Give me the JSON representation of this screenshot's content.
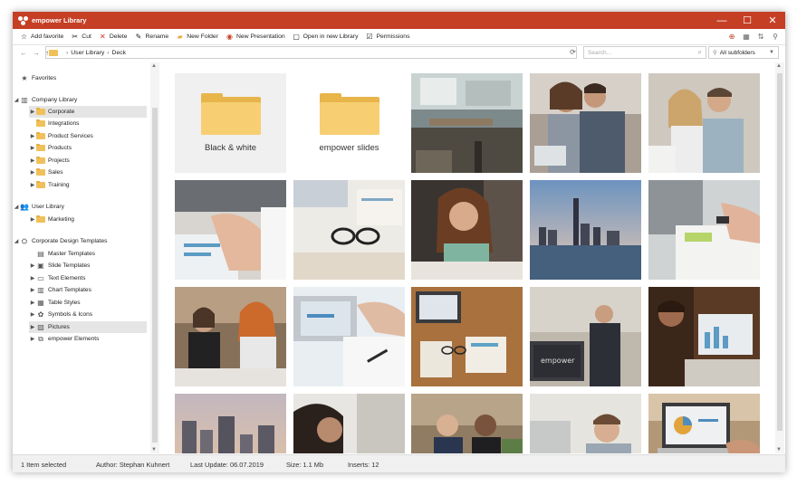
{
  "app": {
    "title": "empower Library"
  },
  "window_controls": {
    "minimize": "—",
    "maximize": "☐",
    "close": "✕"
  },
  "toolbar": {
    "items": [
      {
        "label": "Add favorite",
        "icon": "star-icon",
        "glyph": "☆"
      },
      {
        "label": "Cut",
        "icon": "scissors-icon",
        "glyph": "✂"
      },
      {
        "label": "Delete",
        "icon": "delete-icon",
        "glyph": "✕"
      },
      {
        "label": "Rename",
        "icon": "rename-icon",
        "glyph": "✎"
      },
      {
        "label": "New Folder",
        "icon": "new-folder-icon",
        "glyph": "▰"
      },
      {
        "label": "New Presentation",
        "icon": "new-presentation-icon",
        "glyph": "◉"
      },
      {
        "label": "Open in new Library",
        "icon": "open-library-icon",
        "glyph": "▢"
      },
      {
        "label": "Permissions",
        "icon": "permissions-icon",
        "glyph": "☑"
      }
    ]
  },
  "address": {
    "breadcrumb": [
      "User Library",
      "Deck"
    ],
    "search_placeholder": "Search...",
    "filter": "All subfolders"
  },
  "sidebar": {
    "favorites": "Favorites",
    "company_library": "Company Library",
    "company_items": [
      "Corporate",
      "Integrations",
      "Product Services",
      "Products",
      "Projects",
      "Sales",
      "Training"
    ],
    "user_library": "User Library",
    "user_items": [
      "Marketing"
    ],
    "design_templates": "Corporate Design Templates",
    "design_items": [
      "Master Templates",
      "Slide Templates",
      "Text Elements",
      "Chart Templates",
      "Table Styles",
      "Symbols & Icons",
      "Pictures",
      "empower Elements"
    ],
    "selected_company": "Corporate",
    "selected_design": "Pictures"
  },
  "content": {
    "folders": [
      "Black & white",
      "empower slides"
    ]
  },
  "status": {
    "selection": "1 Item selected",
    "author": "Author: Stephan Kuhnert",
    "last_update": "Last Update: 06.07.2019",
    "size": "Size: 1.1 Mb",
    "inserts": "Inserts: 12"
  },
  "colors": {
    "titlebar": "#c53f25",
    "folder": "#f0c05a",
    "selection": "#e5e5e5"
  }
}
